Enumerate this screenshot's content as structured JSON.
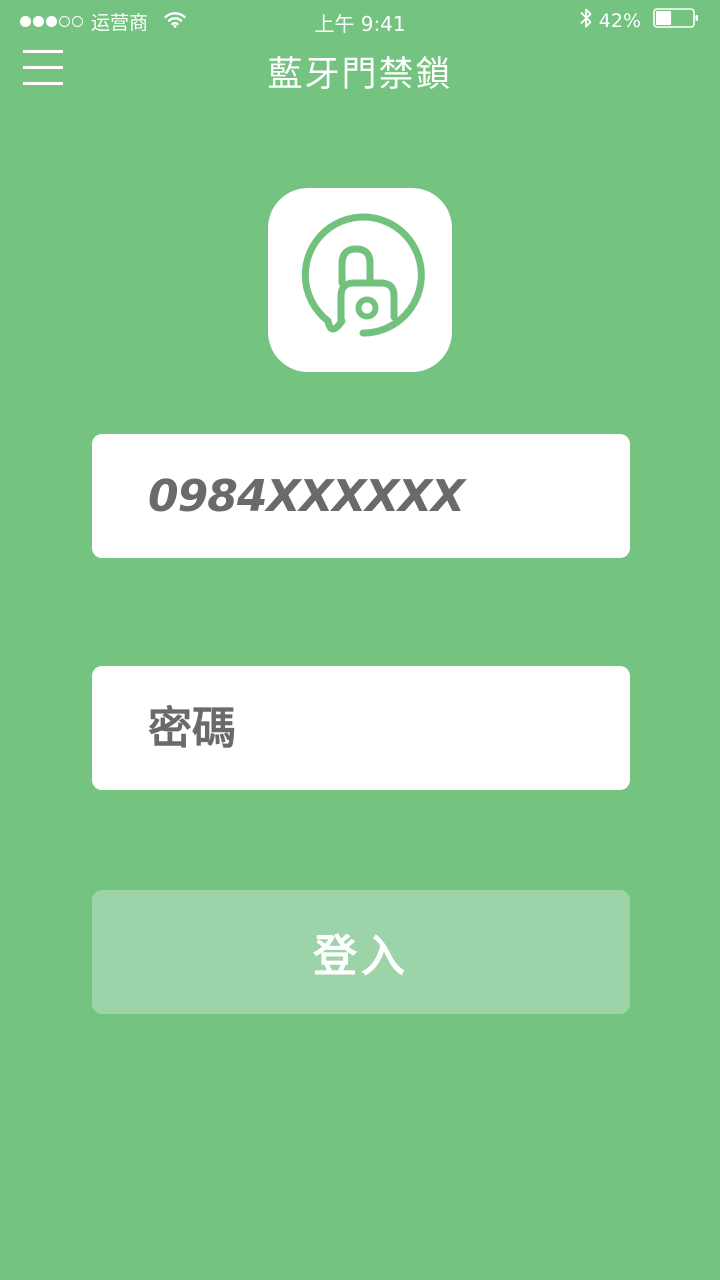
{
  "status_bar": {
    "carrier": "运营商",
    "signal_filled": 3,
    "signal_total": 5,
    "time": "上午 9:41",
    "battery_percent": "42%",
    "battery_level": 0.42,
    "icons": [
      "wifi-icon",
      "bluetooth-icon",
      "battery-icon"
    ]
  },
  "nav": {
    "title": "藍牙門禁鎖",
    "menu_icon": "hamburger-menu-icon"
  },
  "logo": {
    "icon": "unlocked-padlock-icon"
  },
  "form": {
    "phone_placeholder": "0984XXXXXX",
    "password_placeholder": "密碼"
  },
  "login_button": {
    "label": "登入"
  },
  "colors": {
    "background": "#74c380",
    "brand_green": "#72c27e",
    "button_disabled": "#9dd3a8",
    "input_text": "#6a6a6a",
    "white": "#ffffff"
  }
}
